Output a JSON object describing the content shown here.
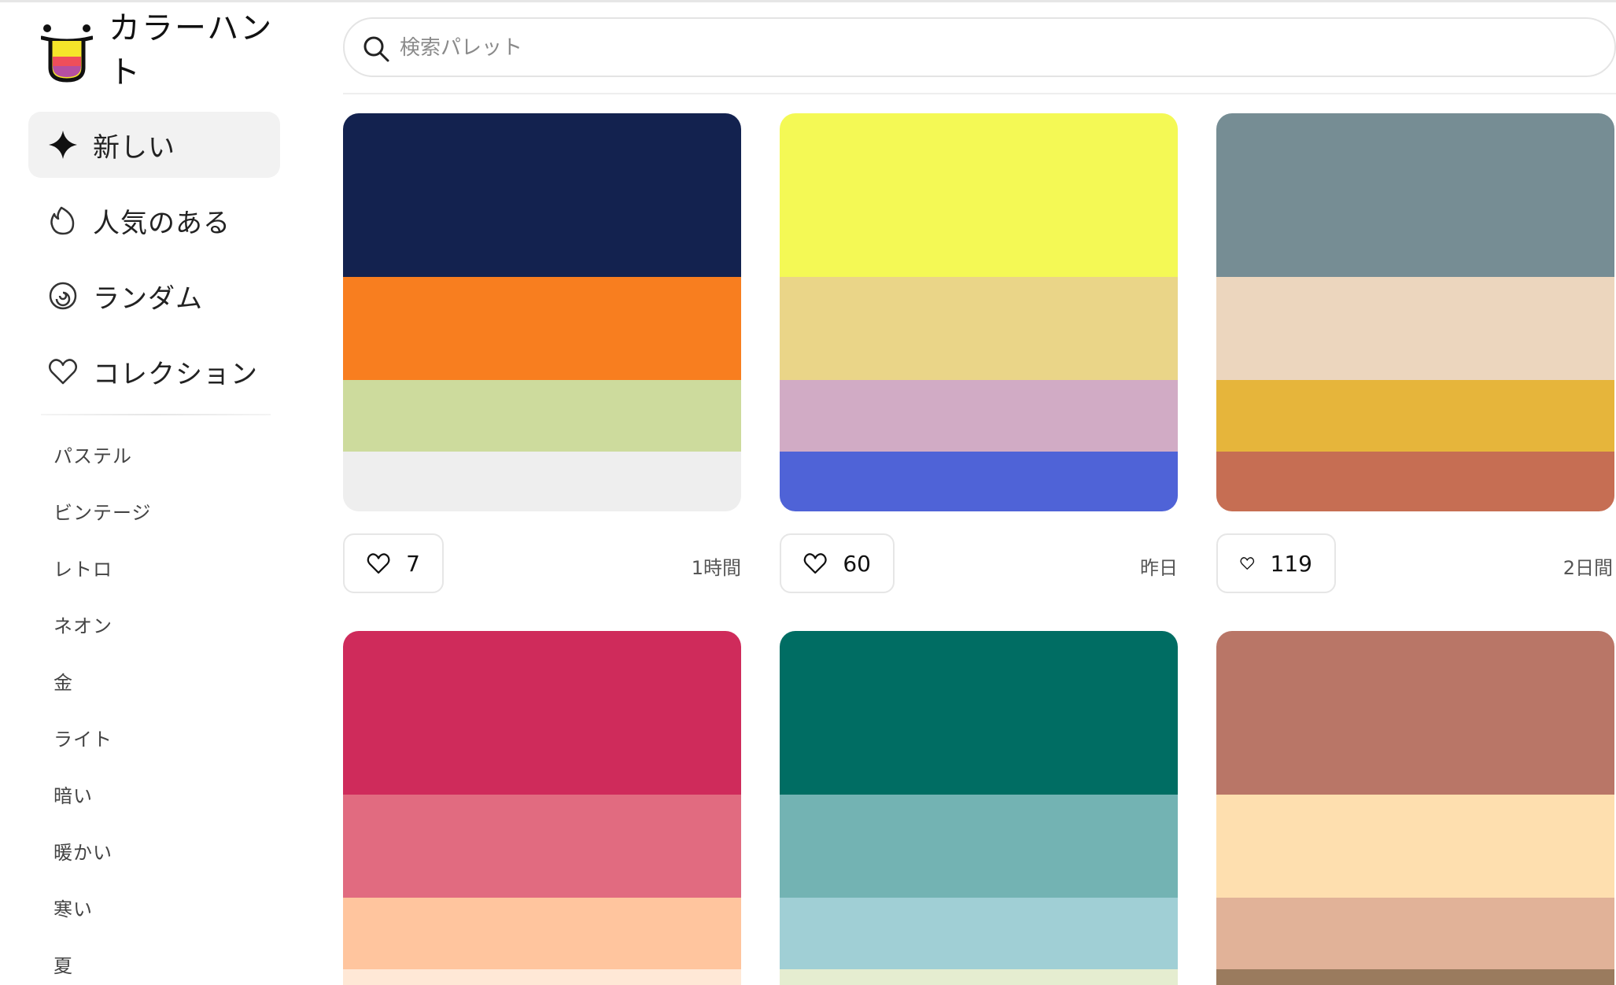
{
  "app": {
    "logo_text": "カラーハント",
    "logo_colors": [
      "#f5e52a",
      "#ef4e5b",
      "#b64fa1"
    ]
  },
  "search": {
    "placeholder": "検索パレット",
    "value": ""
  },
  "nav": {
    "items": [
      {
        "label": "新しい",
        "icon": "sparkle-icon",
        "active": true
      },
      {
        "label": "人気のある",
        "icon": "flame-icon",
        "active": false
      },
      {
        "label": "ランダム",
        "icon": "spiral-icon",
        "active": false
      },
      {
        "label": "コレクション",
        "icon": "heart-icon",
        "active": false
      }
    ]
  },
  "tags": [
    "パステル",
    "ビンテージ",
    "レトロ",
    "ネオン",
    "金",
    "ライト",
    "暗い",
    "暖かい",
    "寒い",
    "夏"
  ],
  "palettes": [
    {
      "colors": [
        "#13224f",
        "#f87e1f",
        "#cddb9d",
        "#eeeeee"
      ],
      "likes": "7",
      "time": "1時間"
    },
    {
      "colors": [
        "#f4f955",
        "#ead588",
        "#d1abc5",
        "#4f63d7"
      ],
      "likes": "60",
      "time": "昨日"
    },
    {
      "colors": [
        "#768d94",
        "#ecd6be",
        "#e6b53b",
        "#c66e53"
      ],
      "likes": "119",
      "time": "2日間"
    },
    {
      "colors": [
        "#cf2b5b",
        "#e16b80",
        "#ffc59e",
        "#ffe8d6"
      ],
      "likes": "",
      "time": ""
    },
    {
      "colors": [
        "#006d63",
        "#73b3b3",
        "#a0cfd5",
        "#e5edd0"
      ],
      "likes": "",
      "time": ""
    },
    {
      "colors": [
        "#b97667",
        "#fedfaf",
        "#e1b298",
        "#9a7b5e"
      ],
      "likes": "",
      "time": ""
    }
  ]
}
